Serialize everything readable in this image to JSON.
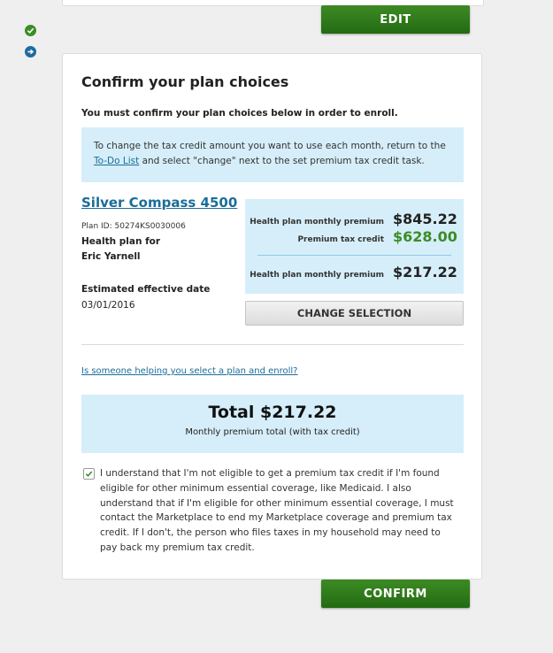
{
  "buttons": {
    "edit_label": "EDIT",
    "confirm_label": "CONFIRM",
    "change_selection_label": "CHANGE SELECTION"
  },
  "status_icons": [
    {
      "icon": "check-circle-icon",
      "color": "#3b8d26"
    },
    {
      "icon": "arrow-right-circle-icon",
      "color": "#1e6aa2"
    }
  ],
  "card": {
    "title": "Confirm your plan choices",
    "must_confirm": "You must confirm your plan choices below in order to enroll.",
    "info": {
      "text_before": "To change the tax credit amount you want to use each month, return to the",
      "link": "To-Do List",
      "text_after": "and select \"change\" next to the set premium tax credit task."
    }
  },
  "plan": {
    "name": "Silver Compass 4500",
    "plan_id": "Plan ID: 50274KS0030006",
    "for_label": "Health plan for",
    "member_name": "Eric Yarnell",
    "effective_label": "Estimated effective date",
    "effective_date": "03/01/2016"
  },
  "pricing": {
    "premium_label": "Health plan monthly premium",
    "premium_value": "$845.22",
    "credit_label": "Premium tax credit",
    "credit_value": "$628.00",
    "net_label": "Health plan monthly premium",
    "net_value": "$217.22"
  },
  "helper_link": "Is someone helping you select a plan and enroll?",
  "total": {
    "headline": "Total $217.22",
    "subtext": "Monthly premium total (with tax credit)"
  },
  "agreement": {
    "checked": true,
    "text": "I understand that I'm not eligible to get a premium tax credit if I'm found eligible for other minimum essential coverage, like Medicaid. I also understand that if I'm eligible for other minimum essential coverage, I must contact the Marketplace to end my Marketplace coverage and premium tax credit. If I don't, the person who files taxes in my household may need to pay back my premium tax credit."
  },
  "colors": {
    "primary_green": "#2f7d1b",
    "link_blue": "#1a6d99",
    "info_bg": "#d6eef9",
    "credit_green": "#3b8d26"
  }
}
